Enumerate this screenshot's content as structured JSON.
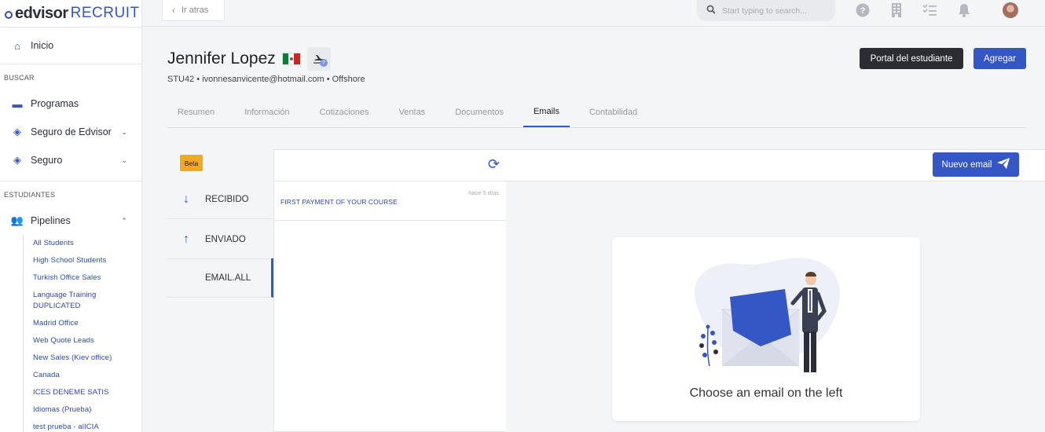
{
  "app": {
    "logo_word": "edvisor",
    "logo_product": "RECRUIT"
  },
  "sidebar": {
    "home": {
      "label": "Inicio"
    },
    "search_section": "BUSCAR",
    "search_items": [
      {
        "label": "Programas"
      },
      {
        "label": "Seguro de Edvisor"
      },
      {
        "label": "Seguro"
      }
    ],
    "students_section": "ESTUDIANTES",
    "pipelines": {
      "label": "Pipelines",
      "items": [
        "All Students",
        "High School Students",
        "Turkish Office Sales",
        "Language Training DUPLICATED",
        "Madrid Office",
        "Web Quote Leads",
        "New Sales (Kiev office)",
        "Canada",
        "ICES DENEME SATIS",
        "Idiomas (Prueba)",
        "test prueba - alICIA"
      ]
    }
  },
  "topbar": {
    "back_label": "Ir atras",
    "search_placeholder": "Start typing to search..."
  },
  "student": {
    "name": "Jennifer Lopez",
    "details": "STU42 • ivonnesanvicente@hotmail.com • Offshore"
  },
  "actions": {
    "portal_label": "Portal del estudiante",
    "add_label": "Agregar"
  },
  "tabs": [
    {
      "label": "Resumen"
    },
    {
      "label": "Información"
    },
    {
      "label": "Cotizaciones"
    },
    {
      "label": "Ventas"
    },
    {
      "label": "Documentos"
    },
    {
      "label": "Emails"
    },
    {
      "label": "Contabilidad"
    }
  ],
  "emails": {
    "beta_label": "Beta",
    "folders": [
      {
        "label": "RECIBIDO"
      },
      {
        "label": "ENVIADO"
      },
      {
        "label": "EMAIL.ALL"
      }
    ],
    "messages": [
      {
        "subject": "FIRST PAYMENT OF YOUR COURSE",
        "date": "hace 5 días"
      }
    ],
    "new_email_label": "Nuevo email",
    "empty_text": "Choose an email on the left"
  },
  "colors": {
    "accent": "#3557c6",
    "dark_button": "#2b2d33",
    "beta": "#f5a623"
  }
}
